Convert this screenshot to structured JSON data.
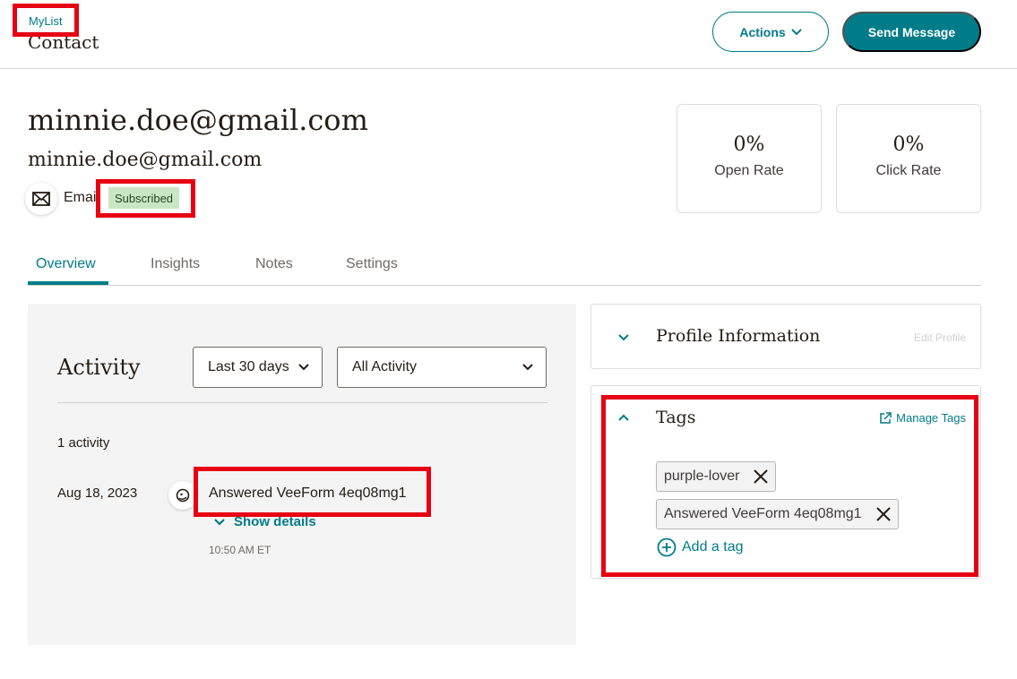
{
  "header": {
    "breadcrumb": "MyList",
    "title": "Contact",
    "actions_label": "Actions",
    "send_label": "Send Message"
  },
  "contact": {
    "email_title": "minnie.doe@gmail.com",
    "email_subtitle": "minnie.doe@gmail.com",
    "channel_label": "Email",
    "status_badge": "Subscribed"
  },
  "stats": [
    {
      "value": "0%",
      "label": "Open Rate"
    },
    {
      "value": "0%",
      "label": "Click Rate"
    }
  ],
  "tabs": [
    {
      "label": "Overview",
      "active": true
    },
    {
      "label": "Insights",
      "active": false
    },
    {
      "label": "Notes",
      "active": false
    },
    {
      "label": "Settings",
      "active": false
    }
  ],
  "activity": {
    "title": "Activity",
    "range_select": "Last 30 days",
    "type_select": "All Activity",
    "count": "1 activity",
    "items": [
      {
        "date": "Aug 18, 2023",
        "name": "Answered VeeForm 4eq08mg1",
        "details_label": "Show details",
        "time": "10:50 AM ET"
      }
    ]
  },
  "profile_card": {
    "title": "Profile Information",
    "edit_label": "Edit Profile"
  },
  "tags_card": {
    "title": "Tags",
    "manage_label": "Manage Tags",
    "tags": [
      "purple-lover",
      "Answered VeeForm 4eq08mg1"
    ],
    "add_label": "Add a tag"
  },
  "colors": {
    "accent": "#007c89",
    "highlight": "#e60012",
    "badge_bg": "#c9e7c2"
  },
  "icons": [
    "mail-icon",
    "chevron-down-icon",
    "chevron-up-icon",
    "mailchimp-icon",
    "external-link-icon",
    "close-icon",
    "plus-circle-icon"
  ]
}
